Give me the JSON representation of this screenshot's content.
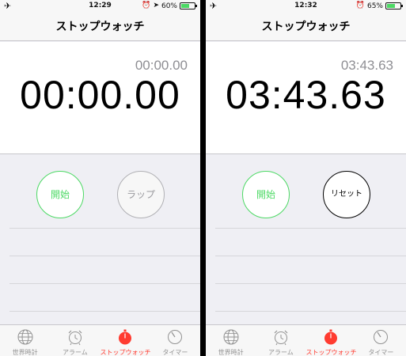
{
  "screens": [
    {
      "status": {
        "time": "12:29",
        "battery": "60%",
        "battery_level": 0.6,
        "location_icon": true
      },
      "title": "ストップウォッチ",
      "lap_time": "00:00.00",
      "main_time": "00:00.00",
      "buttons": {
        "left": "開始",
        "right": "ラップ"
      },
      "tabs": [
        "世界時計",
        "アラーム",
        "ストップウォッチ",
        "タイマー"
      ],
      "active_tab": 2
    },
    {
      "status": {
        "time": "12:32",
        "battery": "65%",
        "battery_level": 0.65,
        "location_icon": false
      },
      "title": "ストップウォッチ",
      "lap_time": "03:43.63",
      "main_time": "03:43.63",
      "buttons": {
        "left": "開始",
        "right": "リセット"
      },
      "tabs": [
        "世界時計",
        "アラーム",
        "ストップウォッチ",
        "タイマー"
      ],
      "active_tab": 2
    }
  ],
  "colors": {
    "accent_green": "#4cd964",
    "active_tab_red": "#ff3b30",
    "battery_green": "#4cd964"
  },
  "icons": [
    "airplane-icon",
    "alarm-clock-icon",
    "location-arrow-icon",
    "globe-icon",
    "stopwatch-icon",
    "timer-icon"
  ]
}
